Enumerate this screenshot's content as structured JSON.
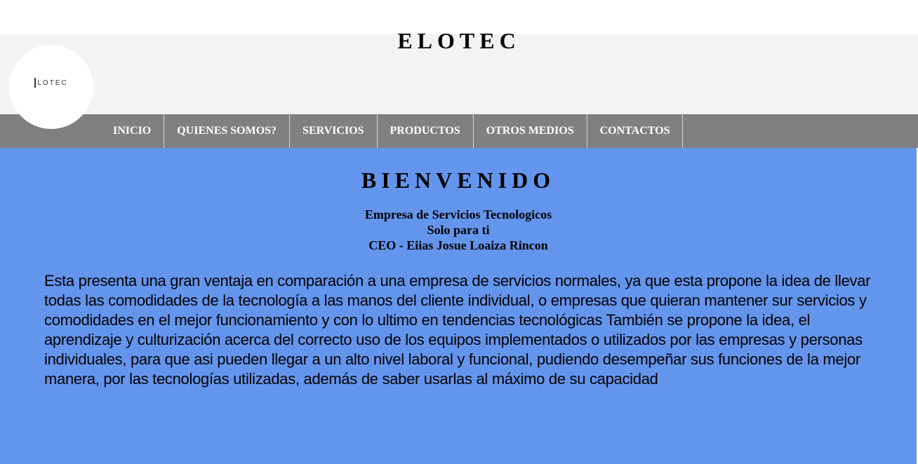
{
  "site": {
    "title": "ELOTEC",
    "logo_text": "LOTEC"
  },
  "nav": {
    "items": [
      {
        "label": "INICIO"
      },
      {
        "label": "QUIENES SOMOS?"
      },
      {
        "label": "SERVICIOS"
      },
      {
        "label": "PRODUCTOS"
      },
      {
        "label": "OTROS MEDIOS"
      },
      {
        "label": "CONTACTOS"
      }
    ]
  },
  "main": {
    "heading": "BIENVENIDO",
    "tagline": [
      "Empresa de Servicios Tecnologicos",
      "Solo para ti",
      "CEO - Eiias Josue Loaiza Rincon"
    ],
    "description": "Esta presenta una gran ventaja en comparación a una empresa de servicios normales, ya que esta propone la idea de llevar todas las comodidades de la tecnología a las manos del cliente individual, o empresas que quieran mantener sur servicios y comodidades en el mejor funcionamiento y con lo ultimo en tendencias tecnológicas También se propone la idea, el aprendizaje y culturización acerca del correcto uso de los equipos implementados o utilizados por las empresas y personas individuales, para que asi pueden llegar a un alto nivel laboral y funcional, pudiendo desempeñar sus funciones de la mejor manera, por las tecnologías utilizadas, además de saber usarlas al máximo de su capacidad"
  },
  "colors": {
    "header_bg": "#f3f3f3",
    "nav_bg": "#808080",
    "main_bg": "#6495ed"
  }
}
